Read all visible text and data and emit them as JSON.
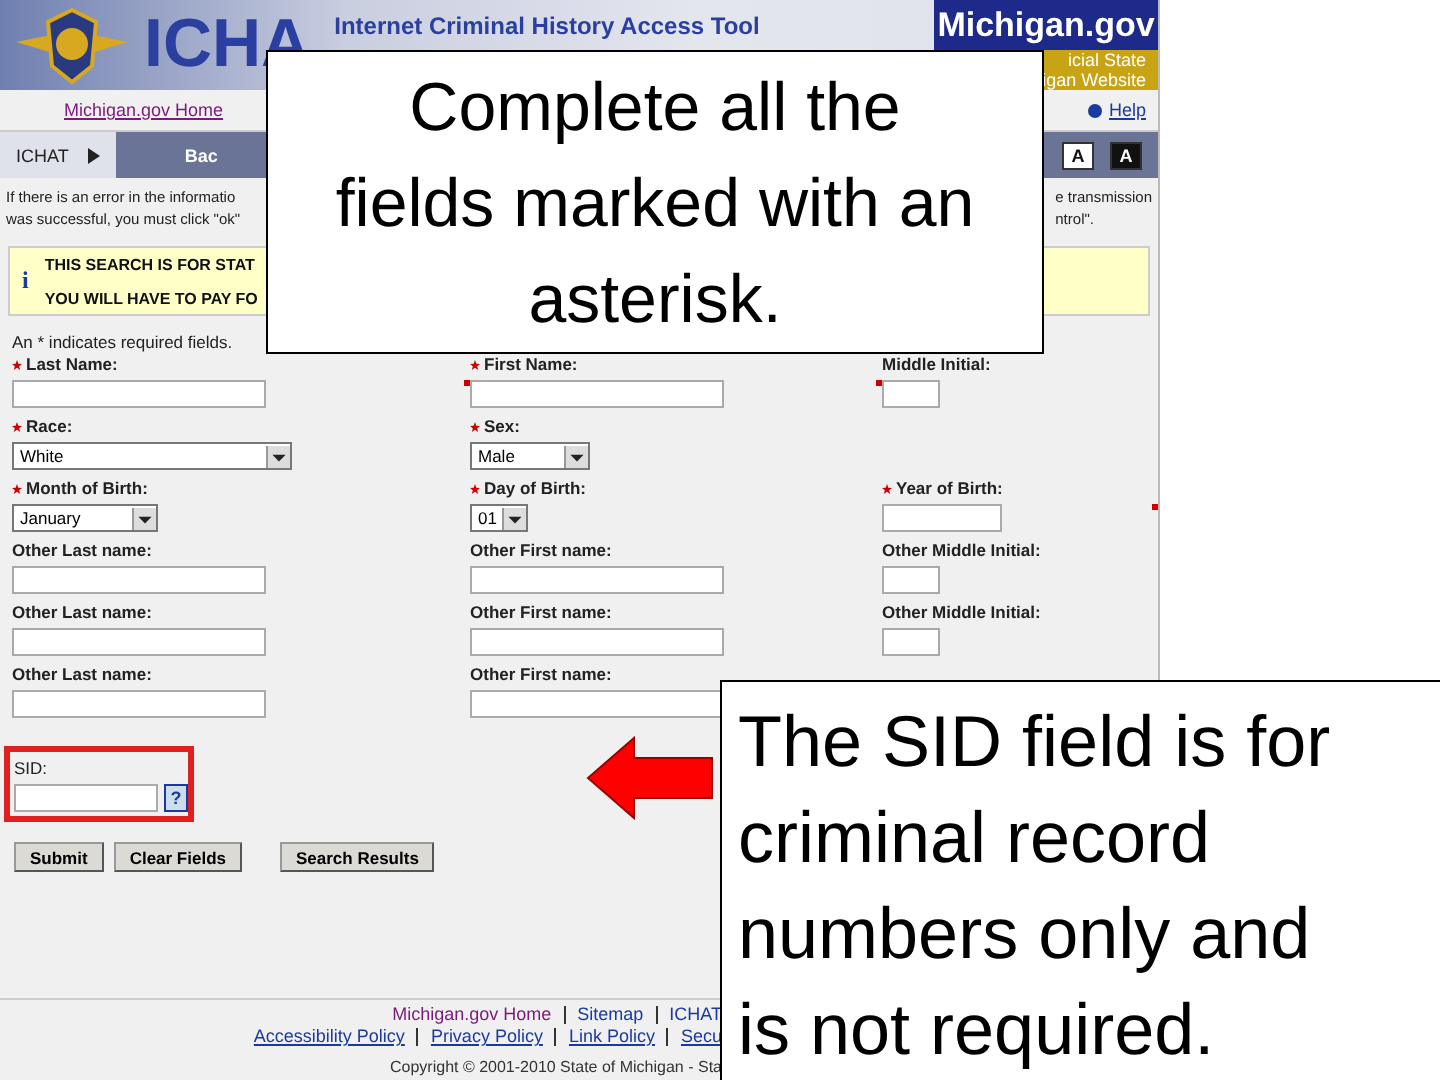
{
  "header": {
    "logo": "ICHA",
    "tool_title": "Internet Criminal History Access Tool",
    "site_badge": "Michigan.gov",
    "tagline": [
      "icial State",
      "igan Website"
    ]
  },
  "nav": {
    "home_link": "Michigan.gov Home",
    "help_link": "Help"
  },
  "tabbar": {
    "tabs": [
      {
        "label": "ICHAT",
        "selected": true
      },
      {
        "label": "Bac",
        "selected": false
      }
    ],
    "text_size_buttons": [
      "A",
      "A"
    ]
  },
  "intro": {
    "left": [
      "If there is an error in the informatio",
      "was successful, you must click \"ok\""
    ],
    "right": [
      "e transmission",
      "ntrol\"."
    ]
  },
  "notice": {
    "icon": "i",
    "lines": [
      "THIS SEARCH IS FOR STAT",
      "YOU **WILL HAVE** TO PAY FO"
    ]
  },
  "required_note": "An * indicates required fields.",
  "form_rows": [
    [
      {
        "label": "Last Name:",
        "required": true,
        "kind": "text"
      },
      {
        "label": "First Name:",
        "required": true,
        "kind": "text"
      },
      {
        "label": "Middle Initial:",
        "required": false,
        "kind": "text"
      }
    ],
    [
      {
        "label": "Race:",
        "required": true,
        "kind": "select",
        "value": "White"
      },
      {
        "label": "Sex:",
        "required": true,
        "kind": "select",
        "value": "Male"
      }
    ],
    [
      {
        "label": "Month of Birth:",
        "required": true,
        "kind": "select",
        "value": "January"
      },
      {
        "label": "Day of Birth:",
        "required": true,
        "kind": "select",
        "value": "01"
      },
      {
        "label": "Year of Birth:",
        "required": true,
        "kind": "text"
      }
    ],
    [
      {
        "label": "Other Last name:",
        "required": false,
        "kind": "text"
      },
      {
        "label": "Other First name:",
        "required": false,
        "kind": "text"
      },
      {
        "label": "Other Middle Initial:",
        "required": false,
        "kind": "text"
      }
    ],
    [
      {
        "label": "Other Last name:",
        "required": false,
        "kind": "text"
      },
      {
        "label": "Other First name:",
        "required": false,
        "kind": "text"
      },
      {
        "label": "Other Middle Initial:",
        "required": false,
        "kind": "text"
      }
    ],
    [
      {
        "label": "Other Last name:",
        "required": false,
        "kind": "text"
      },
      {
        "label": "Other First name:",
        "required": false,
        "kind": "text"
      }
    ]
  ],
  "sid": {
    "label": "SID:",
    "help": "?",
    "highlighted": true
  },
  "buttons": [
    "Submit",
    "Clear Fields",
    "Search Results"
  ],
  "footer": {
    "lines": [
      [
        "Michigan.gov Home",
        "Sitemap",
        "ICHAT"
      ],
      [
        "Accessibility Policy",
        "Privacy Policy",
        "Link Policy",
        "Secu"
      ]
    ],
    "copyright": "Copyright © 2001-2010 State of Michigan - Sta"
  },
  "top_callout": "Complete all the fields marked with an asterisk.",
  "bottom_callout": "The SID field is for criminal record numbers only and is not required."
}
